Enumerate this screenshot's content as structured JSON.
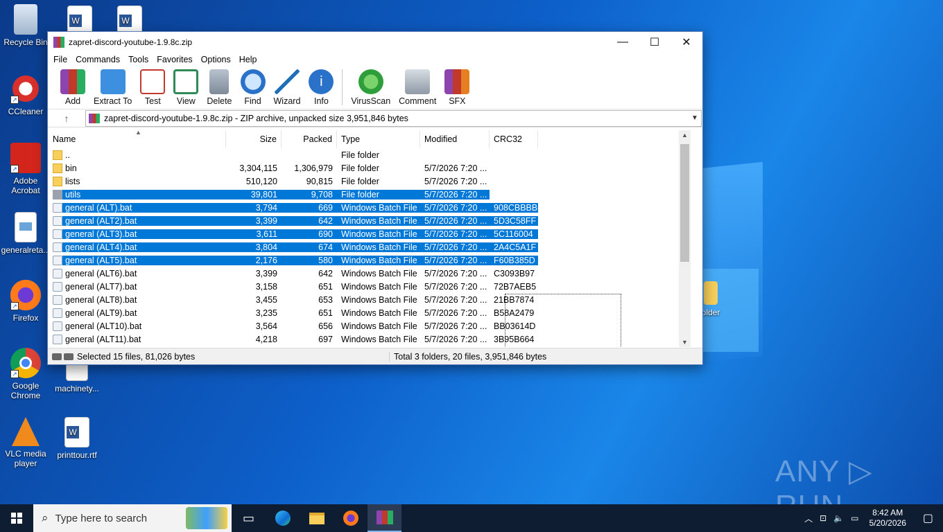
{
  "desktop": {
    "icons": [
      {
        "label": "Recycle Bin"
      },
      {
        "label": "CCleaner"
      },
      {
        "label": "Adobe Acrobat"
      },
      {
        "label": "generalreta..."
      },
      {
        "label": "Firefox"
      },
      {
        "label": "Google Chrome"
      },
      {
        "label": "machinety..."
      },
      {
        "label": "VLC media player"
      },
      {
        "label": "printtour.rtf"
      }
    ],
    "partial_icon_label": "older",
    "watermark": "ANY ▷ RUN"
  },
  "window": {
    "title": "zapret-discord-youtube-1.9.8c.zip",
    "controls": {
      "minimize": "—",
      "maximize": "☐",
      "close": "✕"
    },
    "menu": [
      "File",
      "Commands",
      "Tools",
      "Favorites",
      "Options",
      "Help"
    ],
    "toolbar": [
      {
        "label": "Add",
        "icon": "add-archive-icon",
        "color": "#c0392b"
      },
      {
        "label": "Extract To",
        "icon": "extract-folder-icon",
        "color": "#3d8fe0"
      },
      {
        "label": "Test",
        "icon": "test-clipboard-icon",
        "color": "#c0392b"
      },
      {
        "label": "View",
        "icon": "view-book-icon",
        "color": "#2e8b57"
      },
      {
        "label": "Delete",
        "icon": "trash-icon",
        "color": "#8a98a8"
      },
      {
        "label": "Find",
        "icon": "magnifier-icon",
        "color": "#2a72c9"
      },
      {
        "label": "Wizard",
        "icon": "wand-icon",
        "color": "#1f6fb8"
      },
      {
        "label": "Info",
        "icon": "info-icon",
        "color": "#2a72c9"
      },
      {
        "label": "VirusScan",
        "icon": "virus-scan-icon",
        "color": "#2e9e3a"
      },
      {
        "label": "Comment",
        "icon": "comment-icon",
        "color": "#7f8c8d"
      },
      {
        "label": "SFX",
        "icon": "sfx-box-icon",
        "color": "#e67e22"
      }
    ],
    "address": "zapret-discord-youtube-1.9.8c.zip - ZIP archive, unpacked size 3,951,846 bytes",
    "columns": {
      "name": "Name",
      "size": "Size",
      "packed": "Packed",
      "type": "Type",
      "modified": "Modified",
      "crc": "CRC32"
    },
    "rows": [
      {
        "name": "..",
        "size": "",
        "packed": "",
        "type": "File folder",
        "modified": "",
        "crc": "",
        "icon": "folder",
        "selected": false
      },
      {
        "name": "bin",
        "size": "3,304,115",
        "packed": "1,306,979",
        "type": "File folder",
        "modified": "5/7/2026 7:20 ...",
        "crc": "",
        "icon": "folder",
        "selected": false
      },
      {
        "name": "lists",
        "size": "510,120",
        "packed": "90,815",
        "type": "File folder",
        "modified": "5/7/2026 7:20 ...",
        "crc": "",
        "icon": "folder",
        "selected": false
      },
      {
        "name": "utils",
        "size": "39,801",
        "packed": "9,708",
        "type": "File folder",
        "modified": "5/7/2026 7:20 ...",
        "crc": "",
        "icon": "gray",
        "selected": true
      },
      {
        "name": "general (ALT).bat",
        "size": "3,794",
        "packed": "669",
        "type": "Windows Batch File",
        "modified": "5/7/2026 7:20 ...",
        "crc": "908CBBBB",
        "icon": "bat",
        "selected": true
      },
      {
        "name": "general (ALT2).bat",
        "size": "3,399",
        "packed": "642",
        "type": "Windows Batch File",
        "modified": "5/7/2026 7:20 ...",
        "crc": "5D3C58FF",
        "icon": "bat",
        "selected": true
      },
      {
        "name": "general (ALT3).bat",
        "size": "3,611",
        "packed": "690",
        "type": "Windows Batch File",
        "modified": "5/7/2026 7:20 ...",
        "crc": "5C116004",
        "icon": "bat",
        "selected": true
      },
      {
        "name": "general (ALT4).bat",
        "size": "3,804",
        "packed": "674",
        "type": "Windows Batch File",
        "modified": "5/7/2026 7:20 ...",
        "crc": "2A4C5A1F",
        "icon": "bat",
        "selected": true
      },
      {
        "name": "general (ALT5).bat",
        "size": "2,176",
        "packed": "580",
        "type": "Windows Batch File",
        "modified": "5/7/2026 7:20 ...",
        "crc": "F60B385D",
        "icon": "bat",
        "selected": true
      },
      {
        "name": "general (ALT6).bat",
        "size": "3,399",
        "packed": "642",
        "type": "Windows Batch File",
        "modified": "5/7/2026 7:20 ...",
        "crc": "C3093B97",
        "icon": "bat",
        "selected": false
      },
      {
        "name": "general (ALT7).bat",
        "size": "3,158",
        "packed": "651",
        "type": "Windows Batch File",
        "modified": "5/7/2026 7:20 ...",
        "crc": "72B7AEB5",
        "icon": "bat",
        "selected": false
      },
      {
        "name": "general (ALT8).bat",
        "size": "3,455",
        "packed": "653",
        "type": "Windows Batch File",
        "modified": "5/7/2026 7:20 ...",
        "crc": "21BB7874",
        "icon": "bat",
        "selected": false
      },
      {
        "name": "general (ALT9).bat",
        "size": "3,235",
        "packed": "651",
        "type": "Windows Batch File",
        "modified": "5/7/2026 7:20 ...",
        "crc": "B58A2479",
        "icon": "bat",
        "selected": false
      },
      {
        "name": "general (ALT10).bat",
        "size": "3,564",
        "packed": "656",
        "type": "Windows Batch File",
        "modified": "5/7/2026 7:20 ...",
        "crc": "BB03614D",
        "icon": "bat",
        "selected": false
      },
      {
        "name": "general (ALT11).bat",
        "size": "4,218",
        "packed": "697",
        "type": "Windows Batch File",
        "modified": "5/7/2026 7:20 ...",
        "crc": "3B95B664",
        "icon": "bat",
        "selected": false
      }
    ],
    "status": {
      "selected": "Selected 15 files, 81,026 bytes",
      "total": "Total 3 folders, 20 files, 3,951,846 bytes"
    }
  },
  "taskbar": {
    "search_placeholder": "Type here to search",
    "apps": [
      "task-view-icon",
      "edge-icon",
      "file-explorer-icon",
      "firefox-icon",
      "winrar-icon"
    ],
    "time": "8:42 AM",
    "date": "5/20/2026"
  }
}
